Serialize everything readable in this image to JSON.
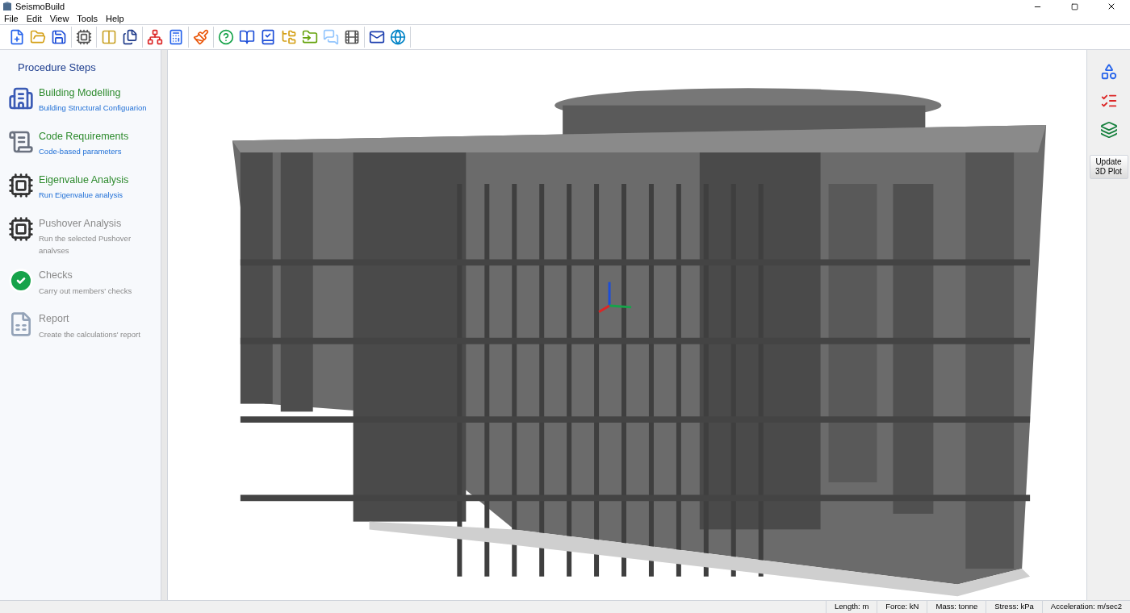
{
  "window": {
    "title": "SeismoBuild"
  },
  "menu": [
    "File",
    "Edit",
    "View",
    "Tools",
    "Help"
  ],
  "sidebar": {
    "title": "Procedure Steps",
    "steps": [
      {
        "kind": "building",
        "title": "Building Modelling",
        "subtitle": "Building Structural Configuarion",
        "enabled": true
      },
      {
        "kind": "code",
        "title": "Code Requirements",
        "subtitle": "Code-based parameters",
        "enabled": true
      },
      {
        "kind": "eigen",
        "title": "Eigenvalue Analysis",
        "subtitle": "Run Eigenvalue analysis",
        "enabled": true
      },
      {
        "kind": "pushover",
        "title": "Pushover Analysis",
        "subtitle": "Run the selected Pushover analvses",
        "enabled": false
      },
      {
        "kind": "checks",
        "title": "Checks",
        "subtitle": "Carry out members' checks",
        "enabled": false
      },
      {
        "kind": "report",
        "title": "Report",
        "subtitle": "Create the calculations' report",
        "enabled": false
      }
    ]
  },
  "right_panel": {
    "update_button": "Update 3D Plot"
  },
  "status_bar": [
    "Length: m",
    "Force: kN",
    "Mass: tonne",
    "Stress: kPa",
    "Acceleration: m/sec2"
  ]
}
